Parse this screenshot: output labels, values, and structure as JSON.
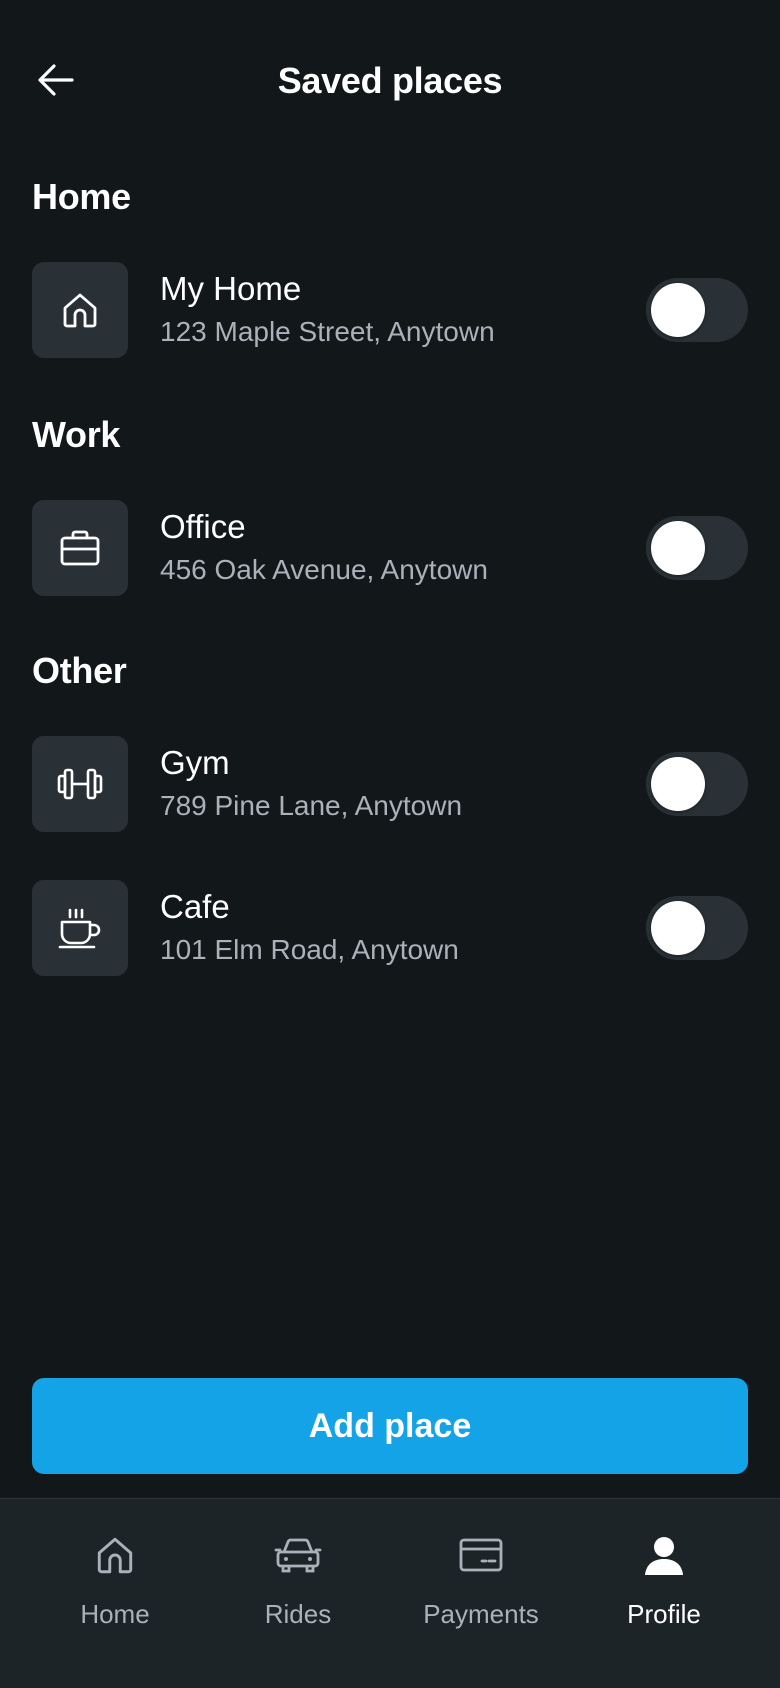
{
  "header": {
    "title": "Saved places",
    "back_icon": "arrow-left-icon"
  },
  "sections": {
    "home": {
      "title": "Home",
      "items": [
        {
          "name": "My Home",
          "address": "123 Maple Street, Anytown",
          "icon": "house-icon",
          "enabled": false
        }
      ]
    },
    "work": {
      "title": "Work",
      "items": [
        {
          "name": "Office",
          "address": "456 Oak Avenue, Anytown",
          "icon": "briefcase-icon",
          "enabled": false
        }
      ]
    },
    "other": {
      "title": "Other",
      "items": [
        {
          "name": "Gym",
          "address": "789 Pine Lane, Anytown",
          "icon": "dumbbell-icon",
          "enabled": false
        },
        {
          "name": "Cafe",
          "address": "101 Elm Road, Anytown",
          "icon": "coffee-cup-icon",
          "enabled": false
        }
      ]
    }
  },
  "add_button": {
    "label": "Add place"
  },
  "nav": {
    "items": [
      {
        "label": "Home",
        "icon": "house-icon",
        "active": false
      },
      {
        "label": "Rides",
        "icon": "car-icon",
        "active": false
      },
      {
        "label": "Payments",
        "icon": "credit-card-icon",
        "active": false
      },
      {
        "label": "Profile",
        "icon": "person-icon",
        "active": true
      }
    ]
  },
  "colors": {
    "background": "#12171a",
    "surface": "#293136",
    "nav_background": "#1d2428",
    "accent": "#15a3e8",
    "text_primary": "#ffffff",
    "text_secondary": "#a8b2b8"
  }
}
